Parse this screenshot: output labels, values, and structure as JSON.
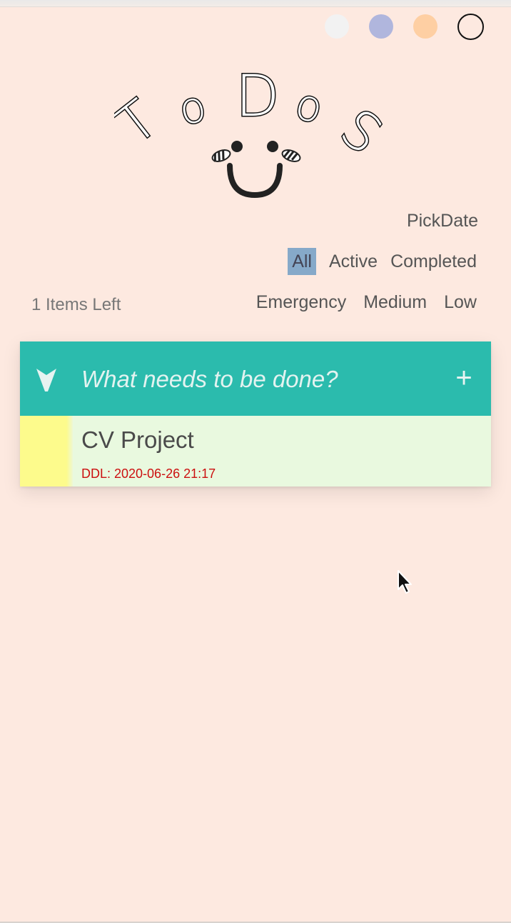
{
  "header": {
    "logo_letters": [
      "T",
      "o",
      "D",
      "o",
      "S"
    ]
  },
  "theme_swatches": [
    {
      "name": "white",
      "color": "#f2f2f2"
    },
    {
      "name": "lavender",
      "color": "#b0b6dd"
    },
    {
      "name": "peach",
      "color": "#fecfa3"
    },
    {
      "name": "outline",
      "color": "#111111"
    }
  ],
  "toolbar": {
    "pick_date": "PickDate",
    "filters": [
      "All",
      "Active",
      "Completed"
    ],
    "selected_filter": "All",
    "items_left": "1 Items Left",
    "priorities": [
      "Emergency",
      "Medium",
      "Low"
    ]
  },
  "new_todo": {
    "placeholder": "What needs to be done?",
    "add_label": "+"
  },
  "todos": [
    {
      "title": "CV Project",
      "deadline": "DDL: 2020-06-26 21:17",
      "priority_color": "#fdfb8c"
    }
  ],
  "colors": {
    "background": "#fde9e0",
    "input_bar": "#2bbbad",
    "todo_background": "#e9f9df",
    "deadline": "#cc1010",
    "selected_filter": "#86a9c9"
  }
}
